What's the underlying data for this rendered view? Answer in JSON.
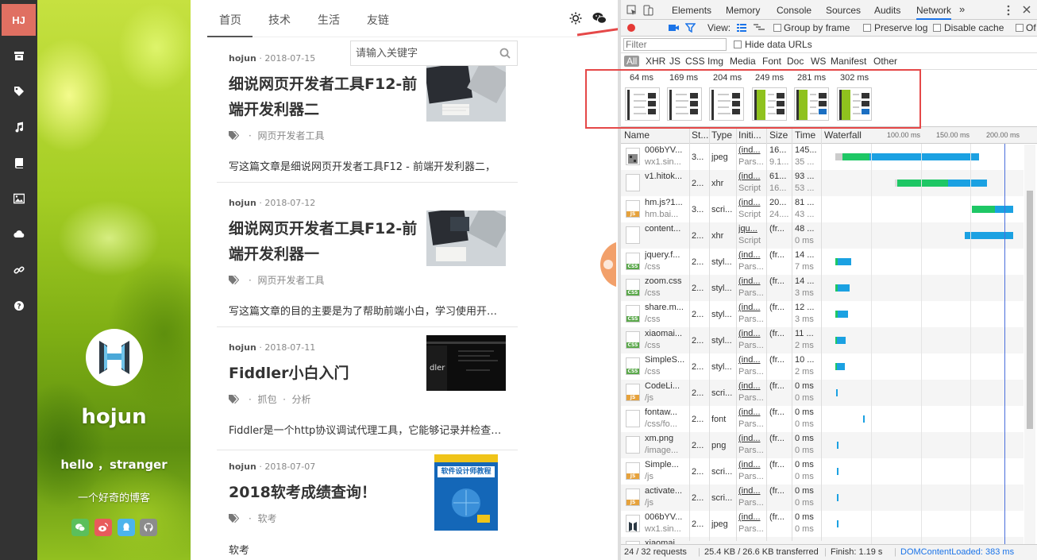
{
  "rail": {
    "logo": "HJ",
    "items": [
      {
        "icon": "archive-icon"
      },
      {
        "icon": "tags-icon"
      },
      {
        "icon": "music-icon"
      },
      {
        "icon": "book-icon"
      },
      {
        "icon": "image-icon"
      },
      {
        "icon": "cloud-icon"
      },
      {
        "icon": "link-icon"
      },
      {
        "icon": "question-icon"
      }
    ]
  },
  "profile": {
    "name": "hojun",
    "greeting": "hello ，stranger",
    "description": "一个好奇的博客",
    "social": [
      "wechat-icon",
      "weibo-icon",
      "qq-icon",
      "github-icon"
    ]
  },
  "nav": {
    "tabs": [
      "首页",
      "技术",
      "生活",
      "友链"
    ],
    "active": "首页",
    "search_placeholder": "请输入关键字"
  },
  "posts": [
    {
      "author": "hojun",
      "date": "2018-07-15",
      "title_line1": "细说网页开发者工具F12-前",
      "title_line2": "端开发利器二",
      "tags": [
        "网页开发者工具"
      ],
      "excerpt": "写这篇文章是细说网页开发者工具F12 - 前端开发利器二，"
    },
    {
      "author": "hojun",
      "date": "2018-07-12",
      "title_line1": "细说网页开发者工具F12-前",
      "title_line2": "端开发利器一",
      "tags": [
        "网页开发者工具"
      ],
      "excerpt": "写这篇文章的目的主要是为了帮助前端小白，学习使用开发者工具"
    },
    {
      "author": "hojun",
      "date": "2018-07-11",
      "title_line1": "Fiddler小白入门",
      "title_line2": "",
      "tags": [
        "抓包",
        "分析"
      ],
      "excerpt": "Fiddler是一个http协议调试代理工具，它能够记录并检查所有"
    },
    {
      "author": "hojun",
      "date": "2018-07-07",
      "title_line1": "2018软考成绩查询！",
      "title_line2": "",
      "tags": [
        "软考"
      ],
      "excerpt": "软考",
      "book_title": "软件设计师教程"
    }
  ],
  "devtools": {
    "tabs": [
      "Elements",
      "Memory",
      "Console",
      "Sources",
      "Audits",
      "Network"
    ],
    "active_tab": "Network",
    "more": "»",
    "toolbar": {
      "view_label": "View:",
      "group_by_frame": "Group by frame",
      "preserve_log": "Preserve log",
      "disable_cache": "Disable cache",
      "offline": "Of"
    },
    "filter_placeholder": "Filter",
    "hide_data_urls": "Hide data URLs",
    "types": [
      "All",
      "XHR",
      "JS",
      "CSS",
      "Img",
      "Media",
      "Font",
      "Doc",
      "WS",
      "Manifest",
      "Other"
    ],
    "frames": [
      "64 ms",
      "169 ms",
      "204 ms",
      "249 ms",
      "281 ms",
      "302 ms"
    ],
    "columns": [
      "Name",
      "St...",
      "Type",
      "Initi...",
      "Size",
      "Time",
      "Waterfall"
    ],
    "timeline_labels": [
      "100.00 ms",
      "150.00 ms",
      "200.00 ms"
    ],
    "rows": [
      {
        "name": "006bYV...",
        "sub": "wx1.sin...",
        "status": "3...",
        "type": "jpeg",
        "init": "(ind...",
        "init2": "Pars...",
        "size": "16...",
        "size2": "9.1...",
        "time": "145...",
        "time2": "35 ...",
        "icon": "image-file-icon"
      },
      {
        "name": "v1.hitok...",
        "sub": "",
        "status": "2...",
        "type": "xhr",
        "init": "(ind...",
        "init2": "Script",
        "size": "61...",
        "size2": "16...",
        "time": "93 ...",
        "time2": "53 ...",
        "icon": "blank-file-icon"
      },
      {
        "name": "hm.js?1...",
        "sub": "hm.bai...",
        "status": "3...",
        "type": "scri...",
        "init": "(ind...",
        "init2": "Script",
        "size": "20...",
        "size2": "24....",
        "time": "81 ...",
        "time2": "43 ...",
        "icon": "js-file-icon"
      },
      {
        "name": "content...",
        "sub": "",
        "status": "2...",
        "type": "xhr",
        "init": "jqu...",
        "init2": "Script",
        "size": "(fr...",
        "size2": "",
        "time": "48 ...",
        "time2": "0 ms",
        "icon": "blank-file-icon"
      },
      {
        "name": "jquery.f...",
        "sub": "/css",
        "status": "2...",
        "type": "styl...",
        "init": "(ind...",
        "init2": "Pars...",
        "size": "(fr...",
        "size2": "",
        "time": "14 ...",
        "time2": "7 ms",
        "icon": "css-file-icon"
      },
      {
        "name": "zoom.css",
        "sub": "/css",
        "status": "2...",
        "type": "styl...",
        "init": "(ind...",
        "init2": "Pars...",
        "size": "(fr...",
        "size2": "",
        "time": "14 ...",
        "time2": "3 ms",
        "icon": "css-file-icon"
      },
      {
        "name": "share.m...",
        "sub": "/css",
        "status": "2...",
        "type": "styl...",
        "init": "(ind...",
        "init2": "Pars...",
        "size": "(fr...",
        "size2": "",
        "time": "12 ...",
        "time2": "3 ms",
        "icon": "css-file-icon"
      },
      {
        "name": "xiaomai...",
        "sub": "/css",
        "status": "2...",
        "type": "styl...",
        "init": "(ind...",
        "init2": "Pars...",
        "size": "(fr...",
        "size2": "",
        "time": "11 ...",
        "time2": "2 ms",
        "icon": "css-file-icon"
      },
      {
        "name": "SimpleS...",
        "sub": "/css",
        "status": "2...",
        "type": "styl...",
        "init": "(ind...",
        "init2": "Pars...",
        "size": "(fr...",
        "size2": "",
        "time": "10 ...",
        "time2": "2 ms",
        "icon": "css-file-icon"
      },
      {
        "name": "CodeLi...",
        "sub": "/js",
        "status": "2...",
        "type": "scri...",
        "init": "(ind...",
        "init2": "Pars...",
        "size": "(fr...",
        "size2": "",
        "time": "0 ms",
        "time2": "0 ms",
        "icon": "js-file-icon"
      },
      {
        "name": "fontaw...",
        "sub": "/css/fo...",
        "status": "2...",
        "type": "font",
        "init": "(ind...",
        "init2": "Pars...",
        "size": "(fr...",
        "size2": "",
        "time": "0 ms",
        "time2": "0 ms",
        "icon": "blank-file-icon"
      },
      {
        "name": "xm.png",
        "sub": "/image...",
        "status": "2...",
        "type": "png",
        "init": "(ind...",
        "init2": "Pars...",
        "size": "(fr...",
        "size2": "",
        "time": "0 ms",
        "time2": "0 ms",
        "icon": "png-file-icon"
      },
      {
        "name": "Simple...",
        "sub": "/js",
        "status": "2...",
        "type": "scri...",
        "init": "(ind...",
        "init2": "Pars...",
        "size": "(fr...",
        "size2": "",
        "time": "0 ms",
        "time2": "0 ms",
        "icon": "js-file-icon"
      },
      {
        "name": "activate...",
        "sub": "/js",
        "status": "2...",
        "type": "scri...",
        "init": "(ind...",
        "init2": "Pars...",
        "size": "(fr...",
        "size2": "",
        "time": "0 ms",
        "time2": "0 ms",
        "icon": "js-file-icon"
      },
      {
        "name": "006bYV...",
        "sub": "wx1.sin...",
        "status": "2...",
        "type": "jpeg",
        "init": "(ind...",
        "init2": "Pars...",
        "size": "(fr...",
        "size2": "",
        "time": "0 ms",
        "time2": "0 ms",
        "icon": "logo-file-icon"
      },
      {
        "name": "xiaomai...",
        "sub": "",
        "status": "",
        "type": "",
        "init": "",
        "init2": "",
        "size": "",
        "size2": "",
        "time": "",
        "time2": "",
        "icon": "css-file-icon"
      }
    ],
    "status": {
      "requests": "24 / 32 requests",
      "transferred": "25.4 KB / 26.6 KB transferred",
      "finish": "Finish: 1.19 s",
      "dcl": "DOMContentLoaded: 383 ms"
    }
  },
  "colors": {
    "accent": "#e07062",
    "network_blue": "#1a73e8",
    "waterfall_green": "#1ec765",
    "waterfall_blue": "#1ba1e2",
    "annotation_red": "#e54848"
  }
}
